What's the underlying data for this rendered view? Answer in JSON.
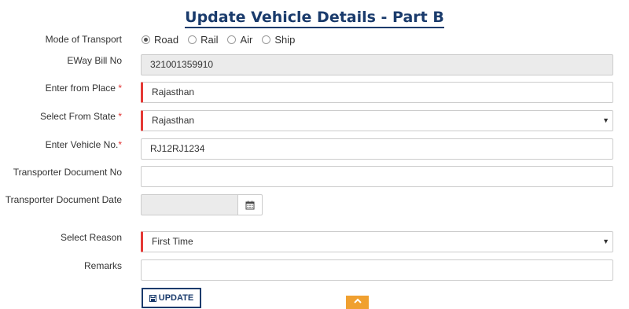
{
  "page": {
    "title": "Update Vehicle Details - Part B"
  },
  "form": {
    "mode_label": "Mode of Transport",
    "modes": [
      "Road",
      "Rail",
      "Air",
      "Ship"
    ],
    "selected_mode": "Road",
    "eway_label": "EWay Bill No",
    "eway_value": "321001359910",
    "from_place_label": "Enter from Place",
    "from_place_value": "Rajasthan",
    "from_state_label": "Select From State",
    "from_state_value": "Rajasthan",
    "vehicle_label": "Enter Vehicle No.",
    "vehicle_value": "RJ12RJ1234",
    "doc_no_label": "Transporter Document No",
    "doc_no_value": "",
    "doc_date_label": "Transporter Document Date",
    "doc_date_value": "",
    "reason_label": "Select Reason",
    "reason_value": "First Time",
    "remarks_label": "Remarks",
    "remarks_value": "",
    "required_mark": "*",
    "update_label": "UPDATE"
  },
  "icons": {
    "calendar": "calendar-icon",
    "save": "floppy-icon",
    "scroll_top": "chevron-up-icon"
  },
  "colors": {
    "title": "#1a3b6c",
    "required_bar": "#e53935",
    "scroll_top_bg": "#f0a030"
  }
}
